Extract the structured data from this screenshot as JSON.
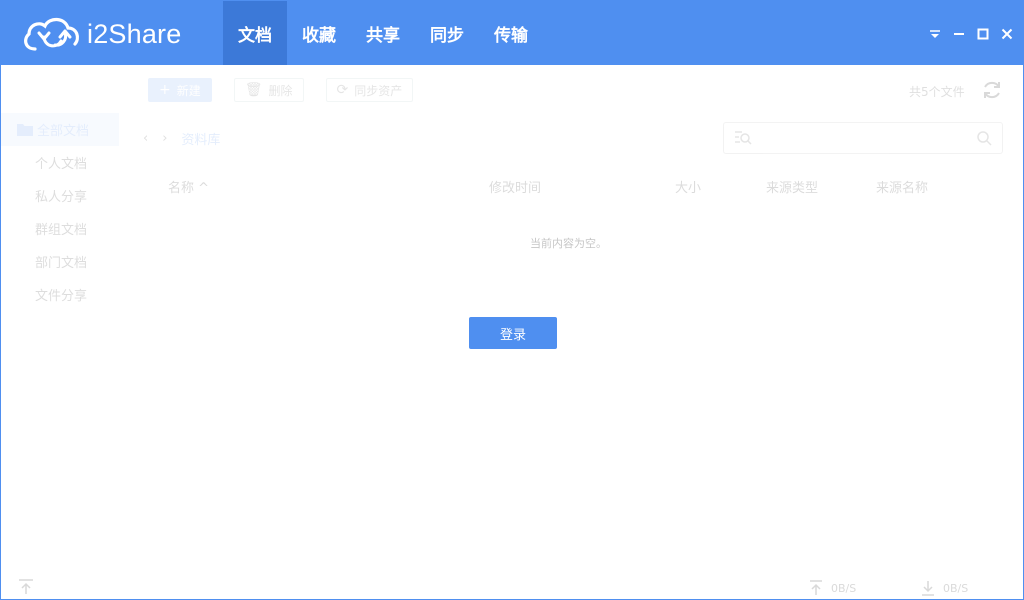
{
  "app": {
    "name": "i2Share"
  },
  "nav": {
    "tabs": [
      "文档",
      "收藏",
      "共享",
      "同步",
      "传输"
    ],
    "active": "文档"
  },
  "toolbar": {
    "new_label": "新建",
    "delete_label": "删除",
    "sync_label": "同步资产"
  },
  "file_count": "共5个文件",
  "sidebar": {
    "items": [
      "全部文档",
      "个人文档",
      "私人分享",
      "群组文档",
      "部门文档",
      "文件分享"
    ]
  },
  "breadcrumb": {
    "current": "资料库"
  },
  "search": {
    "placeholder": ""
  },
  "table": {
    "columns": [
      "名称",
      "修改时间",
      "大小",
      "来源类型",
      "来源名称"
    ],
    "empty_message": "当前内容为空。"
  },
  "login_button": "登录",
  "footer": {
    "upload_speed": "0B/S",
    "download_speed": "0B/S"
  },
  "colors": {
    "brand": "#4f8ff0",
    "active_tab": "#3c79d8"
  }
}
